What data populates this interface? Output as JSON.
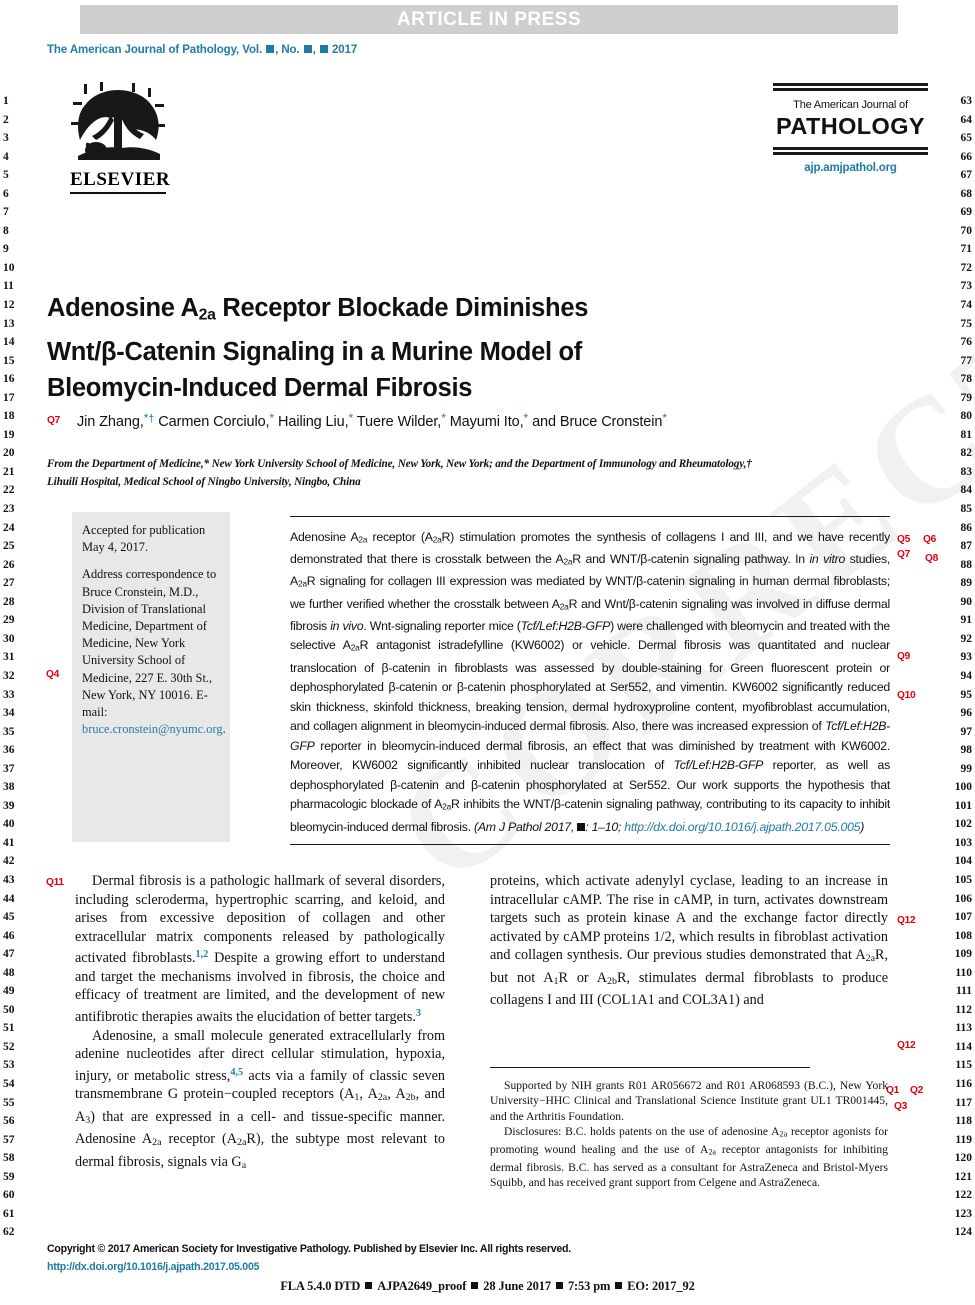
{
  "banner": {
    "text": "ARTICLE IN PRESS"
  },
  "journal_line": {
    "prefix": "The American Journal of Pathology, Vol. ",
    "mid": ", No. ",
    "suffix": ", ",
    "year": "2017"
  },
  "elsevier": {
    "wordmark": "ELSEVIER"
  },
  "ajp_logo": {
    "the_line": "The American Journal of",
    "name": "PATHOLOGY",
    "url": "ajp.amjpathol.org"
  },
  "title": {
    "line1_a": "Adenosine A",
    "line1_sub": "2a",
    "line1_b": " Receptor Blockade Diminishes",
    "line2": "Wnt/β-Catenin Signaling in a Murine Model of",
    "line3": "Bleomycin-Induced Dermal Fibrosis"
  },
  "authors": {
    "a1": "Jin Zhang,",
    "a2": "Carmen Corciulo,",
    "a3": "Hailing Liu,",
    "a4": "Tuere Wilder,",
    "a5": "Mayumi Ito,",
    "a6": "and Bruce Cronstein",
    "star": "*",
    "dagger": "†"
  },
  "affiliation": {
    "line1": "From the Department of Medicine,* New York University School of Medicine, New York, New York; and the Department of Immunology and Rheumatology,†",
    "line2": "Lihuili Hospital, Medical School of Ningbo University, Ningbo, China"
  },
  "sidebox": {
    "accepted": "Accepted for publication May 4, 2017.",
    "correspondence": "Address correspondence to Bruce Cronstein, M.D., Division of Translational Medicine, Department of Medicine, New York University School of Medicine, 227 E. 30th St., New York, NY 10016. E-mail:",
    "email": "bruce.cronstein@nyumc.org",
    "email_period": "."
  },
  "abstract": {
    "p1": "Adenosine A2a receptor (A2aR) stimulation promotes the synthesis of collagens I and III, and we have recently demonstrated that there is crosstalk between the A2aR and WNT/β-catenin signaling pathway. In in vitro studies, A2aR signaling for collagen III expression was mediated by WNT/β-catenin signaling in human dermal fibroblasts; we further verified whether the crosstalk between A2aR and Wnt/β-catenin signaling was involved in diffuse dermal fibrosis in vivo. Wnt-signaling reporter mice (Tcf/Lef:H2B-GFP) were challenged with bleomycin and treated with the selective A2aR antagonist istradefylline (KW6002) or vehicle. Dermal fibrosis was quantitated and nuclear translocation of β-catenin in fibroblasts was assessed by double-staining for Green fluorescent protein or dephosphorylated β-catenin or β-catenin phosphorylated at Ser552, and vimentin. KW6002 significantly reduced skin thickness, skinfold thickness, breaking tension, dermal hydroxyproline content, myofibroblast accumulation, and collagen alignment in bleomycin-induced dermal fibrosis. Also, there was increased expression of Tcf/Lef:H2B-GFP reporter in bleomycin-induced dermal fibrosis, an effect that was diminished by treatment with KW6002. Moreover, KW6002 significantly inhibited nuclear translocation of Tcf/Lef:H2B-GFP reporter, as well as dephosphorylated β-catenin and β-catenin phosphorylated at Ser552. Our work supports the hypothesis that pharmacologic blockade of A2aR inhibits the WNT/β-catenin signaling pathway, contributing to its capacity to inhibit bleomycin-induced dermal fibrosis.",
    "citation_prefix": "(Am J Pathol 2017, ",
    "citation_pages": ": 1–10;",
    "doi_url": "http://dx.doi.org/10.1016/j.ajpath.2017.05.005",
    "citation_close": ")"
  },
  "body_left": {
    "p1": "Dermal fibrosis is a pathologic hallmark of several disorders, including scleroderma, hypertrophic scarring, and keloid, and arises from excessive deposition of collagen and other extracellular matrix components released by pathologically activated fibroblasts.",
    "p1_ref": "1,2",
    "p1b": " Despite a growing effort to understand and target the mechanisms involved in fibrosis, the choice and efficacy of treatment are limited, and the development of new antifibrotic therapies awaits the elucidation of better targets.",
    "p1b_ref": "3",
    "p2a": "Adenosine, a small molecule generated extracellularly from adenine nucleotides after direct cellular stimulation, hypoxia, injury, or metabolic stress,",
    "p2_ref": "4,5",
    "p2b": " acts via a family of classic seven transmembrane G protein−coupled receptors (A1, A2a, A2b, and A3) that are expressed in a cell- and tissue-specific manner. Adenosine A2a receptor (A2aR), the subtype most relevant to dermal fibrosis, signals via Ga"
  },
  "body_right": {
    "p1": "proteins, which activate adenylyl cyclase, leading to an increase in intracellular cAMP. The rise in cAMP, in turn, activates downstream targets such as protein kinase A and the exchange factor directly activated by cAMP proteins 1/2, which results in fibroblast activation and collagen synthesis. Our previous studies demonstrated that A2aR, but not A1R or A2bR, stimulates dermal fibroblasts to produce collagens I and III (COL1A1 and COL3A1) and"
  },
  "footnotes": {
    "support": "Supported by NIH grants R01 AR056672 and R01 AR068593 (B.C.), New York University−HHC Clinical and Translational Science Institute grant UL1 TR001445, and the Arthritis Foundation.",
    "disclosures": "Disclosures: B.C. holds patents on the use of adenosine A2a receptor agonists for promoting wound healing and the use of A2a receptor antagonists for inhibiting dermal fibrosis. B.C. has served as a consultant for AstraZeneca and Bristol-Myers Squibb, and has received grant support from Celgene and AstraZeneca."
  },
  "bottom": {
    "copyright": "Copyright © 2017 American Society for Investigative Pathology. Published by Elsevier Inc. All rights reserved.",
    "doi": "http://dx.doi.org/10.1016/j.ajpath.2017.05.005",
    "dtd_1": "FLA 5.4.0 DTD",
    "dtd_2": "AJPA2649_proof",
    "dtd_3": "28 June 2017",
    "dtd_4": "7:53 pm",
    "dtd_5": "EO: 2017_92"
  },
  "queries": {
    "q7_author": "Q7",
    "q4": "Q4",
    "q5": "Q5",
    "q6": "Q6",
    "q7": "Q7",
    "q8": "Q8",
    "q9": "Q9",
    "q10": "Q10",
    "q11": "Q11",
    "q12a": "Q12",
    "q12b": "Q12",
    "q1": "Q1",
    "q2": "Q2",
    "q3": "Q3"
  },
  "line_numbers": {
    "left_start": 1,
    "left_end": 62,
    "right_start": 63,
    "right_end": 124
  },
  "watermark": {
    "text": "CORRECTED PROOF"
  },
  "colors": {
    "accent_blue": "#1f7ca6",
    "query_red": "#e8000a",
    "banner_grey": "#cfcfcf",
    "sidebox_grey": "#e8e8e8"
  }
}
